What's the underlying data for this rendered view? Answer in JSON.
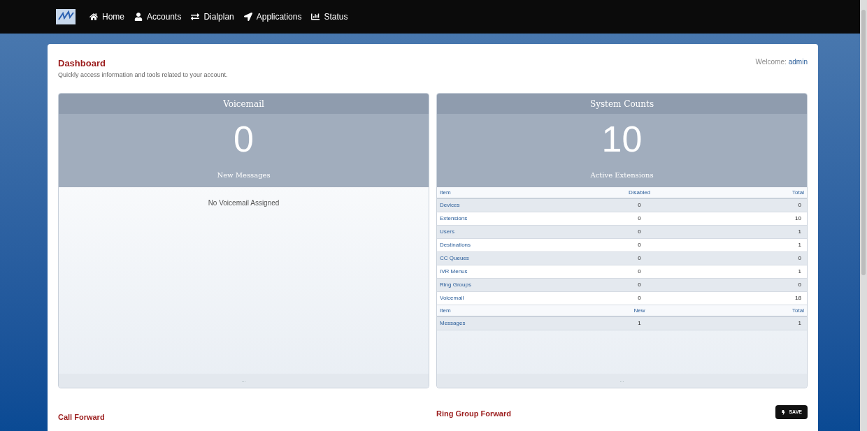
{
  "nav": {
    "items": [
      {
        "label": "Home"
      },
      {
        "label": "Accounts"
      },
      {
        "label": "Dialplan"
      },
      {
        "label": "Applications"
      },
      {
        "label": "Status"
      }
    ]
  },
  "header": {
    "title": "Dashboard",
    "subtitle": "Quickly access information and tools related to your account.",
    "welcome": "Welcome:",
    "user": "admin"
  },
  "voicemail": {
    "title": "Voicemail",
    "count": "0",
    "count_label": "New Messages",
    "message": "No Voicemail Assigned",
    "footer": "..."
  },
  "system_counts": {
    "title": "System Counts",
    "count": "10",
    "count_label": "Active Extensions",
    "footer": "...",
    "tables": [
      {
        "columns": [
          "Item",
          "Disabled",
          "Total"
        ],
        "rows": [
          [
            "Devices",
            "0",
            "0"
          ],
          [
            "Extensions",
            "0",
            "10"
          ],
          [
            "Users",
            "0",
            "1"
          ],
          [
            "Destinations",
            "0",
            "1"
          ],
          [
            "CC Queues",
            "0",
            "0"
          ],
          [
            "IVR Menus",
            "0",
            "1"
          ],
          [
            "Ring Groups",
            "0",
            "0"
          ],
          [
            "Voicemail",
            "0",
            "18"
          ]
        ]
      },
      {
        "columns": [
          "Item",
          "New",
          "Total"
        ],
        "rows": [
          [
            "Messages",
            "1",
            "1"
          ]
        ]
      }
    ]
  },
  "call_forward": {
    "title": "Call Forward"
  },
  "ring_group_forward": {
    "title": "Ring Group Forward",
    "button": "SAVE"
  }
}
